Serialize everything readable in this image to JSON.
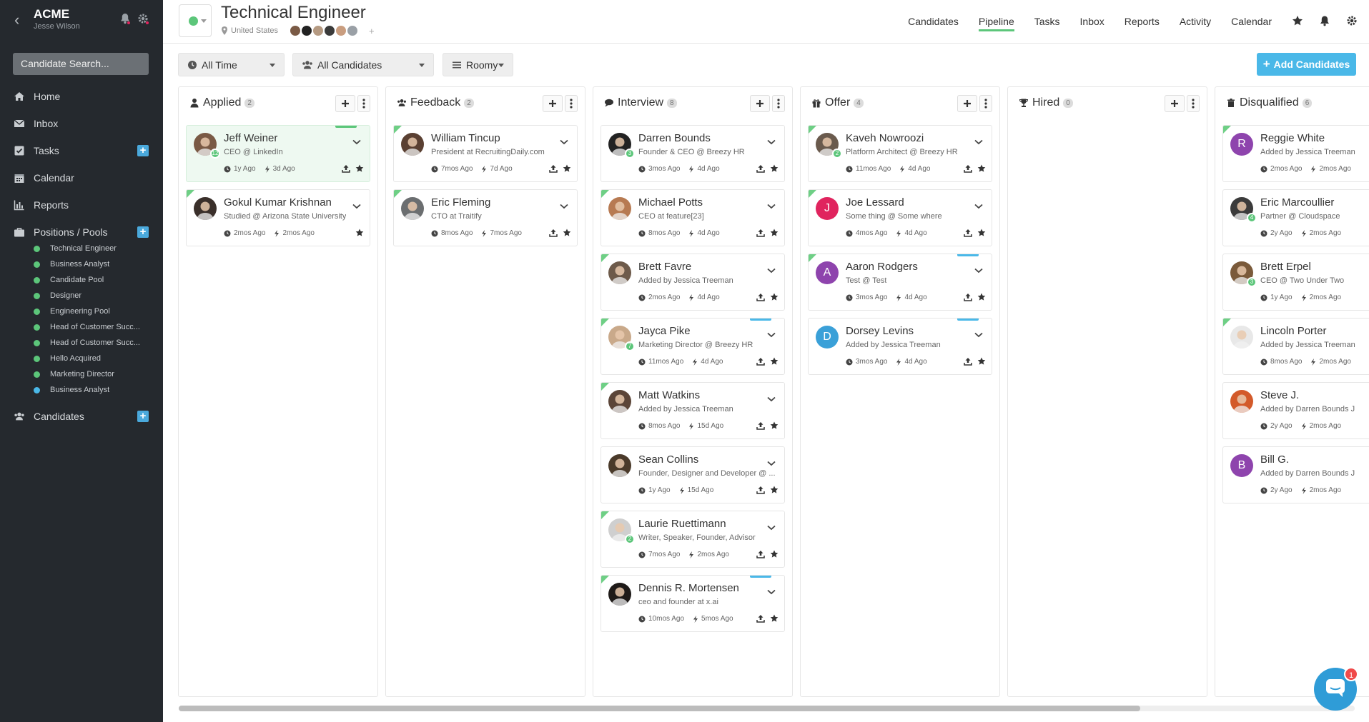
{
  "sidebar": {
    "company": "ACME",
    "user": "Jesse Wilson",
    "search_placeholder": "Candidate Search...",
    "nav": {
      "home": "Home",
      "inbox": "Inbox",
      "tasks": "Tasks",
      "calendar": "Calendar",
      "reports": "Reports",
      "positions": "Positions / Pools",
      "candidates": "Candidates"
    },
    "pools": [
      {
        "label": "Technical Engineer",
        "color": "#5cc67a"
      },
      {
        "label": "Business Analyst",
        "color": "#5cc67a"
      },
      {
        "label": "Candidate Pool",
        "color": "#5cc67a"
      },
      {
        "label": "Designer",
        "color": "#5cc67a"
      },
      {
        "label": "Engineering Pool",
        "color": "#5cc67a"
      },
      {
        "label": "Head of Customer Succ...",
        "color": "#5cc67a"
      },
      {
        "label": "Head of Customer Succ...",
        "color": "#5cc67a"
      },
      {
        "label": "Hello Acquired",
        "color": "#5cc67a"
      },
      {
        "label": "Marketing Director",
        "color": "#5cc67a"
      },
      {
        "label": "Business Analyst",
        "color": "#4ab8e8"
      }
    ]
  },
  "header": {
    "title": "Technical Engineer",
    "location": "United States",
    "team_plus": "+",
    "nav": {
      "candidates": "Candidates",
      "pipeline": "Pipeline",
      "tasks": "Tasks",
      "inbox": "Inbox",
      "reports": "Reports",
      "activity": "Activity",
      "calendar": "Calendar"
    }
  },
  "filters": {
    "time": "All Time",
    "candidates": "All Candidates",
    "view": "Roomy",
    "add_button": "Add Candidates"
  },
  "colors": {
    "accent_green": "#5cc67a",
    "accent_blue": "#4ab8e8",
    "sidebar_bg": "#25292e"
  },
  "columns": [
    {
      "title": "Applied",
      "count": "2",
      "icon": "user-icon",
      "cards": [
        {
          "name": "Jeff Weiner",
          "sub": "CEO @ LinkedIn",
          "t1": "1y Ago",
          "t2": "3d Ago",
          "badge": "12",
          "avatar": "photo",
          "tone": "#7a5a45",
          "highlight": true,
          "bar": "#5cc67a"
        },
        {
          "name": "Gokul Kumar Krishnan",
          "sub": "Studied @ Arizona State University",
          "t1": "2mos Ago",
          "t2": "2mos Ago",
          "avatar": "photo",
          "tone": "#3a2f2a",
          "corner": true,
          "noupload": true
        }
      ]
    },
    {
      "title": "Feedback",
      "count": "2",
      "icon": "users-icon",
      "cards": [
        {
          "name": "William Tincup",
          "sub": "President at RecruitingDaily.com",
          "t1": "7mos Ago",
          "t2": "7d Ago",
          "avatar": "photo",
          "tone": "#5a4032",
          "corner": true
        },
        {
          "name": "Eric Fleming",
          "sub": "CTO at Traitify",
          "t1": "8mos Ago",
          "t2": "7mos Ago",
          "avatar": "photo",
          "tone": "#6b6e70",
          "corner": true
        }
      ]
    },
    {
      "title": "Interview",
      "count": "8",
      "icon": "comments-icon",
      "cards": [
        {
          "name": "Darren Bounds",
          "sub": "Founder & CEO @ Breezy HR",
          "t1": "3mos Ago",
          "t2": "4d Ago",
          "badge": "3",
          "avatar": "photo",
          "tone": "#222222"
        },
        {
          "name": "Michael Potts",
          "sub": "CEO at feature[23]",
          "t1": "8mos Ago",
          "t2": "4d Ago",
          "avatar": "photo",
          "tone": "#b77a52",
          "corner": true
        },
        {
          "name": "Brett Favre",
          "sub": "Added by Jessica Treeman",
          "t1": "2mos Ago",
          "t2": "4d Ago",
          "avatar": "photo",
          "tone": "#6d5a4a",
          "corner": true
        },
        {
          "name": "Jayca Pike",
          "sub": "Marketing Director @ Breezy HR",
          "t1": "11mos Ago",
          "t2": "4d Ago",
          "badge": "7",
          "avatar": "photo",
          "tone": "#c9a98a",
          "corner": true,
          "bar": "#4ab8e8"
        },
        {
          "name": "Matt Watkins",
          "sub": "Added by Jessica Treeman",
          "t1": "8mos Ago",
          "t2": "15d Ago",
          "avatar": "photo",
          "tone": "#5b4538",
          "corner": true
        },
        {
          "name": "Sean Collins",
          "sub": "Founder, Designer and Developer @ ...",
          "t1": "1y Ago",
          "t2": "15d Ago",
          "avatar": "photo",
          "tone": "#4a3a2a"
        },
        {
          "name": "Laurie Ruettimann",
          "sub": "Writer, Speaker, Founder, Advisor",
          "t1": "7mos Ago",
          "t2": "2mos Ago",
          "badge": "2",
          "avatar": "photo",
          "tone": "#cfcfcf",
          "corner": true
        },
        {
          "name": "Dennis R. Mortensen",
          "sub": "ceo and founder at x.ai",
          "t1": "10mos Ago",
          "t2": "5mos Ago",
          "avatar": "photo",
          "tone": "#1e1a18",
          "corner": true,
          "bar": "#4ab8e8"
        }
      ]
    },
    {
      "title": "Offer",
      "count": "4",
      "icon": "gift-icon",
      "cards": [
        {
          "name": "Kaveh Nowroozi",
          "sub": "Platform Architect @ Breezy HR",
          "t1": "11mos Ago",
          "t2": "4d Ago",
          "badge": "2",
          "avatar": "photo",
          "tone": "#6a5a4d",
          "corner": true
        },
        {
          "name": "Joe Lessard",
          "sub": "Some thing @ Some where",
          "t1": "4mos Ago",
          "t2": "4d Ago",
          "avatar": "letter",
          "letter": "J",
          "tone": "#e0245e",
          "corner": true
        },
        {
          "name": "Aaron Rodgers",
          "sub": "Test @ Test",
          "t1": "3mos Ago",
          "t2": "4d Ago",
          "avatar": "letter",
          "letter": "A",
          "tone": "#8e44ad",
          "corner": true,
          "bar": "#4ab8e8"
        },
        {
          "name": "Dorsey Levins",
          "sub": "Added by Jessica Treeman",
          "t1": "3mos Ago",
          "t2": "4d Ago",
          "avatar": "letter",
          "letter": "D",
          "tone": "#3aa0d8",
          "bar": "#4ab8e8"
        }
      ]
    },
    {
      "title": "Hired",
      "count": "0",
      "icon": "trophy-icon",
      "cards": []
    },
    {
      "title": "Disqualified",
      "count": "6",
      "icon": "trash-icon",
      "cards": [
        {
          "name": "Reggie White",
          "sub": "Added by Jessica Treeman",
          "t1": "2mos Ago",
          "t2": "2mos Ago",
          "avatar": "letter",
          "letter": "R",
          "tone": "#8e44ad",
          "corner": true
        },
        {
          "name": "Eric Marcoullier",
          "sub": "Partner @ Cloudspace",
          "t1": "2y Ago",
          "t2": "2mos Ago",
          "badge": "4",
          "avatar": "photo",
          "tone": "#3b3b3b"
        },
        {
          "name": "Brett Erpel",
          "sub": "CEO @ Two Under Two",
          "t1": "1y Ago",
          "t2": "2mos Ago",
          "badge": "3",
          "avatar": "photo",
          "tone": "#7a5a3a"
        },
        {
          "name": "Lincoln Porter",
          "sub": "Added by Jessica Treeman",
          "t1": "8mos Ago",
          "t2": "2mos Ago",
          "avatar": "photo",
          "tone": "#e8e8e8",
          "corner": true
        },
        {
          "name": "Steve J.",
          "sub": "Added by Darren Bounds J",
          "t1": "2y Ago",
          "t2": "2mos Ago",
          "avatar": "photo",
          "tone": "#d35a2a"
        },
        {
          "name": "Bill G.",
          "sub": "Added by Darren Bounds J",
          "t1": "2y Ago",
          "t2": "2mos Ago",
          "avatar": "letter",
          "letter": "B",
          "tone": "#8e44ad"
        }
      ]
    }
  ],
  "chat": {
    "unread": "1"
  }
}
